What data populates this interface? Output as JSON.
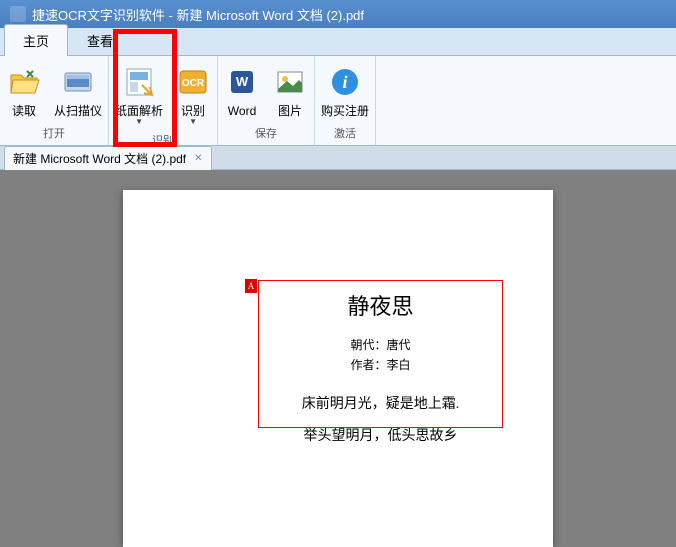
{
  "window": {
    "title": "捷速OCR文字识别软件 - 新建 Microsoft Word 文档 (2).pdf"
  },
  "tabs": {
    "home": "主页",
    "view": "查看"
  },
  "ribbon": {
    "open_group": "打开",
    "recognize_group": "识别",
    "save_group": "保存",
    "activate_group": "激活",
    "read": "读取",
    "from_scanner": "从扫描仪",
    "page_analysis": "纸面解析",
    "recognize": "识别",
    "word": "Word",
    "image": "图片",
    "buy_register": "购买注册"
  },
  "doc_tab": {
    "name": "新建 Microsoft Word 文档 (2).pdf"
  },
  "ocr": {
    "marker": "A",
    "title": "静夜思",
    "dynasty_label": "朝代：",
    "dynasty": "唐代",
    "author_label": "作者：",
    "author": "李白",
    "line1": "床前明月光，疑是地上霜.",
    "line2": "举头望明月，低头思故乡"
  }
}
